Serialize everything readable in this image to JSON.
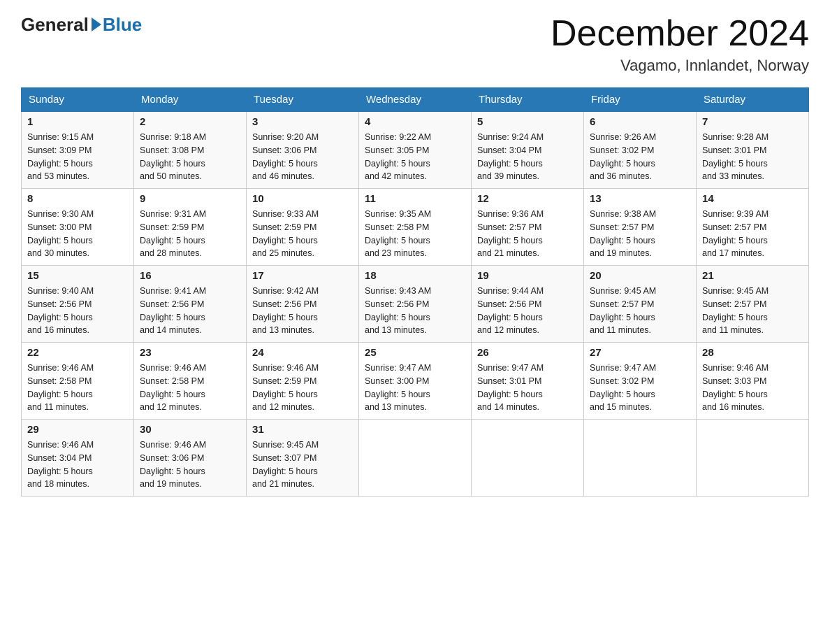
{
  "header": {
    "logo_general": "General",
    "logo_blue": "Blue",
    "month_title": "December 2024",
    "location": "Vagamo, Innlandet, Norway"
  },
  "days_of_week": [
    "Sunday",
    "Monday",
    "Tuesday",
    "Wednesday",
    "Thursday",
    "Friday",
    "Saturday"
  ],
  "weeks": [
    [
      {
        "day": "1",
        "sunrise": "Sunrise: 9:15 AM",
        "sunset": "Sunset: 3:09 PM",
        "daylight": "Daylight: 5 hours",
        "daylight2": "and 53 minutes."
      },
      {
        "day": "2",
        "sunrise": "Sunrise: 9:18 AM",
        "sunset": "Sunset: 3:08 PM",
        "daylight": "Daylight: 5 hours",
        "daylight2": "and 50 minutes."
      },
      {
        "day": "3",
        "sunrise": "Sunrise: 9:20 AM",
        "sunset": "Sunset: 3:06 PM",
        "daylight": "Daylight: 5 hours",
        "daylight2": "and 46 minutes."
      },
      {
        "day": "4",
        "sunrise": "Sunrise: 9:22 AM",
        "sunset": "Sunset: 3:05 PM",
        "daylight": "Daylight: 5 hours",
        "daylight2": "and 42 minutes."
      },
      {
        "day": "5",
        "sunrise": "Sunrise: 9:24 AM",
        "sunset": "Sunset: 3:04 PM",
        "daylight": "Daylight: 5 hours",
        "daylight2": "and 39 minutes."
      },
      {
        "day": "6",
        "sunrise": "Sunrise: 9:26 AM",
        "sunset": "Sunset: 3:02 PM",
        "daylight": "Daylight: 5 hours",
        "daylight2": "and 36 minutes."
      },
      {
        "day": "7",
        "sunrise": "Sunrise: 9:28 AM",
        "sunset": "Sunset: 3:01 PM",
        "daylight": "Daylight: 5 hours",
        "daylight2": "and 33 minutes."
      }
    ],
    [
      {
        "day": "8",
        "sunrise": "Sunrise: 9:30 AM",
        "sunset": "Sunset: 3:00 PM",
        "daylight": "Daylight: 5 hours",
        "daylight2": "and 30 minutes."
      },
      {
        "day": "9",
        "sunrise": "Sunrise: 9:31 AM",
        "sunset": "Sunset: 2:59 PM",
        "daylight": "Daylight: 5 hours",
        "daylight2": "and 28 minutes."
      },
      {
        "day": "10",
        "sunrise": "Sunrise: 9:33 AM",
        "sunset": "Sunset: 2:59 PM",
        "daylight": "Daylight: 5 hours",
        "daylight2": "and 25 minutes."
      },
      {
        "day": "11",
        "sunrise": "Sunrise: 9:35 AM",
        "sunset": "Sunset: 2:58 PM",
        "daylight": "Daylight: 5 hours",
        "daylight2": "and 23 minutes."
      },
      {
        "day": "12",
        "sunrise": "Sunrise: 9:36 AM",
        "sunset": "Sunset: 2:57 PM",
        "daylight": "Daylight: 5 hours",
        "daylight2": "and 21 minutes."
      },
      {
        "day": "13",
        "sunrise": "Sunrise: 9:38 AM",
        "sunset": "Sunset: 2:57 PM",
        "daylight": "Daylight: 5 hours",
        "daylight2": "and 19 minutes."
      },
      {
        "day": "14",
        "sunrise": "Sunrise: 9:39 AM",
        "sunset": "Sunset: 2:57 PM",
        "daylight": "Daylight: 5 hours",
        "daylight2": "and 17 minutes."
      }
    ],
    [
      {
        "day": "15",
        "sunrise": "Sunrise: 9:40 AM",
        "sunset": "Sunset: 2:56 PM",
        "daylight": "Daylight: 5 hours",
        "daylight2": "and 16 minutes."
      },
      {
        "day": "16",
        "sunrise": "Sunrise: 9:41 AM",
        "sunset": "Sunset: 2:56 PM",
        "daylight": "Daylight: 5 hours",
        "daylight2": "and 14 minutes."
      },
      {
        "day": "17",
        "sunrise": "Sunrise: 9:42 AM",
        "sunset": "Sunset: 2:56 PM",
        "daylight": "Daylight: 5 hours",
        "daylight2": "and 13 minutes."
      },
      {
        "day": "18",
        "sunrise": "Sunrise: 9:43 AM",
        "sunset": "Sunset: 2:56 PM",
        "daylight": "Daylight: 5 hours",
        "daylight2": "and 13 minutes."
      },
      {
        "day": "19",
        "sunrise": "Sunrise: 9:44 AM",
        "sunset": "Sunset: 2:56 PM",
        "daylight": "Daylight: 5 hours",
        "daylight2": "and 12 minutes."
      },
      {
        "day": "20",
        "sunrise": "Sunrise: 9:45 AM",
        "sunset": "Sunset: 2:57 PM",
        "daylight": "Daylight: 5 hours",
        "daylight2": "and 11 minutes."
      },
      {
        "day": "21",
        "sunrise": "Sunrise: 9:45 AM",
        "sunset": "Sunset: 2:57 PM",
        "daylight": "Daylight: 5 hours",
        "daylight2": "and 11 minutes."
      }
    ],
    [
      {
        "day": "22",
        "sunrise": "Sunrise: 9:46 AM",
        "sunset": "Sunset: 2:58 PM",
        "daylight": "Daylight: 5 hours",
        "daylight2": "and 11 minutes."
      },
      {
        "day": "23",
        "sunrise": "Sunrise: 9:46 AM",
        "sunset": "Sunset: 2:58 PM",
        "daylight": "Daylight: 5 hours",
        "daylight2": "and 12 minutes."
      },
      {
        "day": "24",
        "sunrise": "Sunrise: 9:46 AM",
        "sunset": "Sunset: 2:59 PM",
        "daylight": "Daylight: 5 hours",
        "daylight2": "and 12 minutes."
      },
      {
        "day": "25",
        "sunrise": "Sunrise: 9:47 AM",
        "sunset": "Sunset: 3:00 PM",
        "daylight": "Daylight: 5 hours",
        "daylight2": "and 13 minutes."
      },
      {
        "day": "26",
        "sunrise": "Sunrise: 9:47 AM",
        "sunset": "Sunset: 3:01 PM",
        "daylight": "Daylight: 5 hours",
        "daylight2": "and 14 minutes."
      },
      {
        "day": "27",
        "sunrise": "Sunrise: 9:47 AM",
        "sunset": "Sunset: 3:02 PM",
        "daylight": "Daylight: 5 hours",
        "daylight2": "and 15 minutes."
      },
      {
        "day": "28",
        "sunrise": "Sunrise: 9:46 AM",
        "sunset": "Sunset: 3:03 PM",
        "daylight": "Daylight: 5 hours",
        "daylight2": "and 16 minutes."
      }
    ],
    [
      {
        "day": "29",
        "sunrise": "Sunrise: 9:46 AM",
        "sunset": "Sunset: 3:04 PM",
        "daylight": "Daylight: 5 hours",
        "daylight2": "and 18 minutes."
      },
      {
        "day": "30",
        "sunrise": "Sunrise: 9:46 AM",
        "sunset": "Sunset: 3:06 PM",
        "daylight": "Daylight: 5 hours",
        "daylight2": "and 19 minutes."
      },
      {
        "day": "31",
        "sunrise": "Sunrise: 9:45 AM",
        "sunset": "Sunset: 3:07 PM",
        "daylight": "Daylight: 5 hours",
        "daylight2": "and 21 minutes."
      },
      null,
      null,
      null,
      null
    ]
  ]
}
